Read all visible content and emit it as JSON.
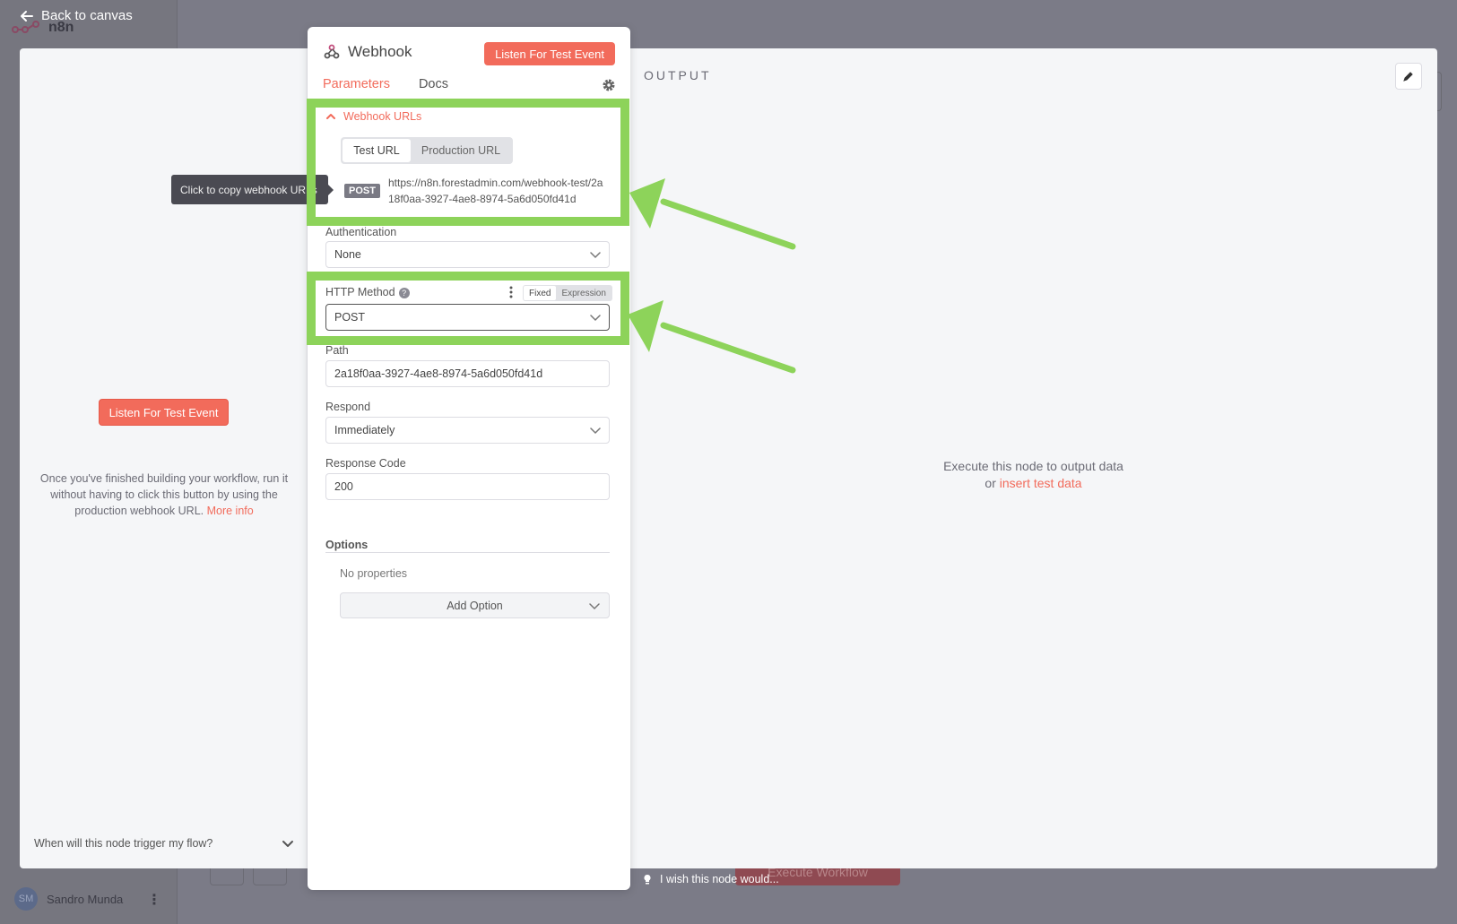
{
  "nav": {
    "back_label": "Back to canvas",
    "logo_text": "n8n"
  },
  "user": {
    "initials": "SM",
    "name": "Sandro Munda"
  },
  "background": {
    "execute_label": "Execute Workflow"
  },
  "node": {
    "title": "Webhook",
    "listen_button": "Listen For Test Event",
    "tabs": [
      {
        "label": "Parameters"
      },
      {
        "label": "Docs"
      }
    ],
    "webhook_urls": {
      "title": "Webhook URLs",
      "toggle": [
        {
          "label": "Test URL"
        },
        {
          "label": "Production URL"
        }
      ],
      "method_badge": "POST",
      "url": "https://n8n.forestadmin.com/webhook-test/2a18f0aa-3927-4ae8-8974-5a6d050fd41d"
    },
    "authentication": {
      "label": "Authentication",
      "value": "None"
    },
    "http_method": {
      "label": "HTTP Method",
      "value": "POST",
      "mode_fixed": "Fixed",
      "mode_expression": "Expression"
    },
    "path": {
      "label": "Path",
      "value": "2a18f0aa-3927-4ae8-8974-5a6d050fd41d"
    },
    "respond": {
      "label": "Respond",
      "value": "Immediately"
    },
    "response_code": {
      "label": "Response Code",
      "value": "200"
    },
    "options": {
      "label": "Options",
      "empty_text": "No properties",
      "add_label": "Add Option"
    }
  },
  "tooltip": {
    "text": "Click to copy webhook URLs"
  },
  "left_pane": {
    "listen_button": "Listen For Test Event",
    "description": "Once you've finished building your workflow, run it without having to click this button by using the production webhook URL.",
    "more_info": "More info",
    "trigger_question": "When will this node trigger my flow?"
  },
  "output": {
    "title": "OUTPUT",
    "message_line1": "Execute this node to output data",
    "message_or": "or",
    "insert_link": "insert test data"
  },
  "feedback": {
    "wish_text": "I wish this node would..."
  },
  "colors": {
    "accent": "#f26b5b",
    "highlight": "#8dd35a"
  }
}
